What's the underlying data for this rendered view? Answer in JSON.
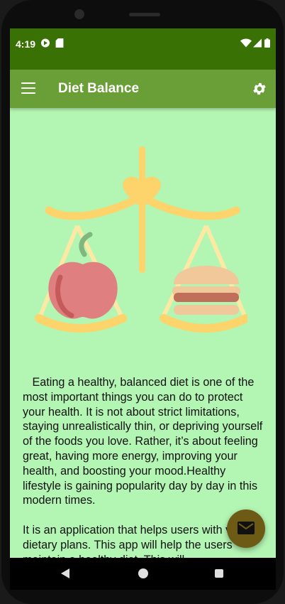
{
  "status_bar": {
    "time": "4:19"
  },
  "app_bar": {
    "title": "Diet Balance",
    "menu_icon": "menu-icon",
    "settings_icon": "gear-icon"
  },
  "illustration": {
    "description_icon": "balance-scale-apple-burger-icon"
  },
  "content": {
    "paragraph_1": "   Eating a healthy, balanced diet is one of the most important things you can do to protect your health. It is not about strict limitations, staying unrealistically thin, or depriving yourself of the foods you love. Rather, it’s about feeling great, having more energy, improving your health, and boosting your mood.Healthy lifestyle is gaining popularity day by day in this modern times.",
    "paragraph_2": "It is an application that helps users with various dietary plans. This app will help the users maintain a healthy diet. This will"
  },
  "fab": {
    "icon": "mail-icon"
  },
  "colors": {
    "status_bar": "#3a7105",
    "app_bar": "#6a9e36",
    "background": "#b3f5b3",
    "fab": "#6d5a14"
  }
}
